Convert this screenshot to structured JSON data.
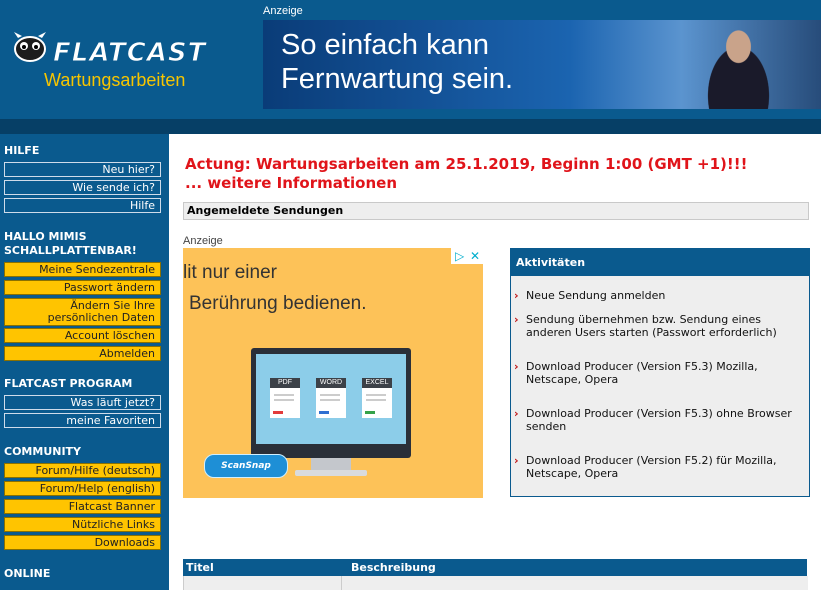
{
  "header": {
    "logo_text": "FLATCAST",
    "subtitle": "Wartungsarbeiten",
    "ad_label": "Anzeige",
    "banner_line1": "So einfach kann",
    "banner_line2": "Fernwartung sein."
  },
  "sidebar": {
    "hilfe": {
      "title": "HILFE",
      "items": [
        "Neu hier?",
        "Wie sende ich?",
        "Hilfe"
      ]
    },
    "user": {
      "title_line1": "HALLO  MIMIS",
      "title_line2": "SCHALLPLATTENBAR!",
      "items": [
        "Meine Sendezentrale",
        "Passwort ändern",
        "Ändern Sie Ihre",
        "persönlichen Daten",
        "Account löschen",
        "Abmelden"
      ]
    },
    "program": {
      "title": "FLATCAST PROGRAM",
      "items": [
        "Was läuft jetzt?",
        "meine Favoriten"
      ]
    },
    "community": {
      "title": "COMMUNITY",
      "items": [
        "Forum/Hilfe (deutsch)",
        "Forum/Help (english)",
        "Flatcast Banner",
        "Nützliche Links",
        "Downloads"
      ]
    },
    "online": {
      "title": "ONLINE"
    }
  },
  "main": {
    "alert_line1": "Actung: Wartungsarbeiten am 25.1.2019, Beginn 1:00 (GMT +1)!!!",
    "alert_line2": "... weitere Informationen",
    "logged_header": "Angemeldete Sendungen",
    "ad_label": "Anzeige"
  },
  "ad": {
    "line1": "lit nur einer",
    "line2": "Berührung bedienen.",
    "docs": [
      "PDF",
      "WORD",
      "EXCEL"
    ],
    "brand": "ScanSnap",
    "choice_icon_1": "▷",
    "choice_icon_2": "✕"
  },
  "activity": {
    "title": "Aktivitäten",
    "items": [
      "Neue Sendung anmelden",
      "Sendung übernehmen bzw. Sendung eines anderen Users starten (Passwort erforderlich)",
      "Download Producer (Version F5.3) Mozilla, Netscape, Opera",
      "Download Producer (Version F5.3) ohne Browser senden",
      "Download Producer (Version F5.2) für Mozilla, Netscape, Opera"
    ]
  },
  "table": {
    "col1": "Titel",
    "col2": "Beschreibung"
  },
  "colors": {
    "brand_blue": "#0a5a8e",
    "link_yellow": "#ffc400",
    "alert_red": "#e0141a"
  }
}
